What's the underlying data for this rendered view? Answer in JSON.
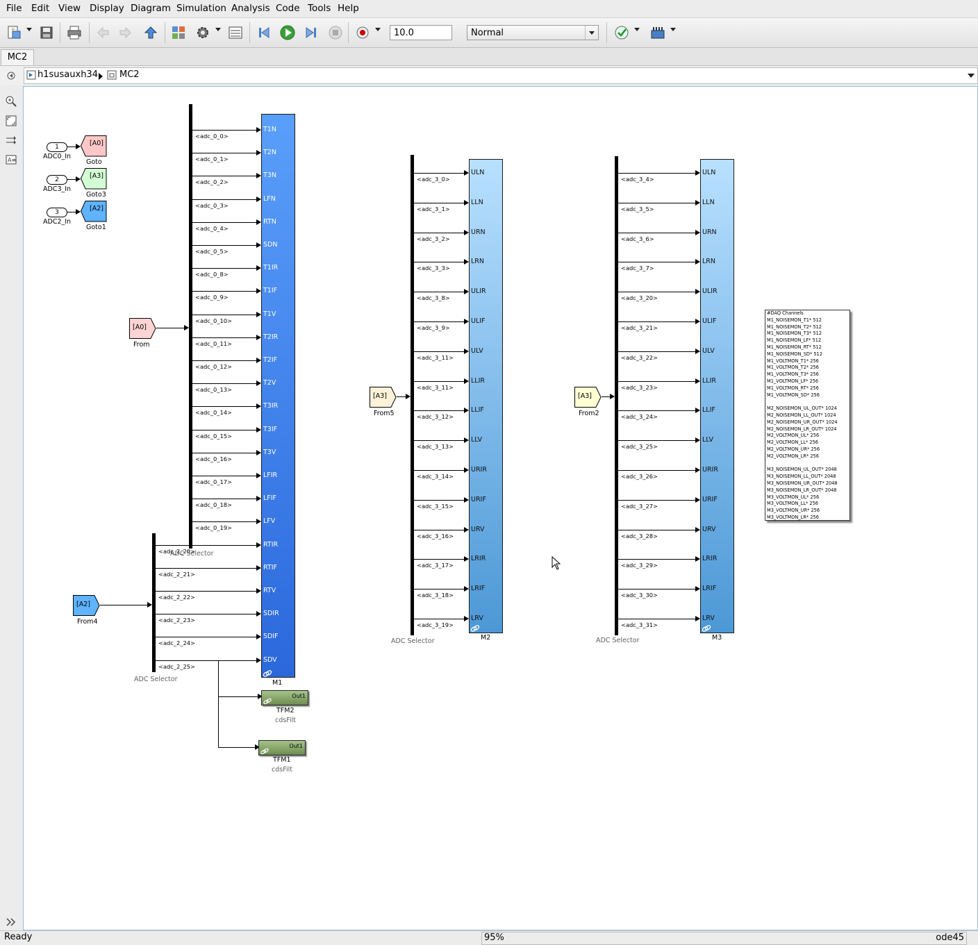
{
  "menu": [
    "File",
    "Edit",
    "View",
    "Display",
    "Diagram",
    "Simulation",
    "Analysis",
    "Code",
    "Tools",
    "Help"
  ],
  "toolbar": {
    "stop_time": "10.0",
    "sim_mode": "Normal"
  },
  "tab": {
    "label": "MC2"
  },
  "breadcrumb": {
    "parent": "h1susauxh34",
    "current": "MC2"
  },
  "status": {
    "left": "Ready",
    "zoom": "95%",
    "solver": "ode45"
  },
  "inports": [
    {
      "num": "1",
      "name": "ADC0_In",
      "tag": "[A0]",
      "goto": "Goto",
      "color": "#ffc8c8"
    },
    {
      "num": "2",
      "name": "ADC3_In",
      "tag": "[A3]",
      "goto": "Goto3",
      "color": "#d4ffd4"
    },
    {
      "num": "3",
      "name": "ADC2_In",
      "tag": "[A2]",
      "goto": "Goto1",
      "color": "#5fb3ff"
    }
  ],
  "froms": [
    {
      "tag": "[A0]",
      "name": "From",
      "color": "#ffd4d4"
    },
    {
      "tag": "[A2]",
      "name": "From4",
      "color": "#5fb3ff"
    },
    {
      "tag": "[A3]",
      "name": "From5",
      "color": "#fff2d9"
    },
    {
      "tag": "[A3]",
      "name": "From2",
      "color": "#ffffd4"
    }
  ],
  "selectors": {
    "s1": "ADC Selector",
    "s2": "ADC Selector",
    "s3": "ADC Selector",
    "s4": "ADC Selector"
  },
  "m1": {
    "name": "M1",
    "ports": [
      "T1N",
      "T2N",
      "T3N",
      "LFN",
      "RTN",
      "SDN",
      "T1IR",
      "T1IF",
      "T1V",
      "T2IR",
      "T2IF",
      "T2V",
      "T3IR",
      "T3IF",
      "T3V",
      "LFIR",
      "LFIF",
      "LFV",
      "RTIR",
      "RTIF",
      "RTV",
      "SDIR",
      "SDIF",
      "SDV"
    ],
    "signals_a": [
      "<adc_0_0>",
      "<adc_0_1>",
      "<adc_0_2>",
      "<adc_0_3>",
      "<adc_0_4>",
      "<adc_0_5>",
      "<adc_0_8>",
      "<adc_0_9>",
      "<adc_0_10>",
      "<adc_0_11>",
      "<adc_0_12>",
      "<adc_0_13>",
      "<adc_0_14>",
      "<adc_0_15>",
      "<adc_0_16>",
      "<adc_0_17>",
      "<adc_0_18>",
      "<adc_0_19>"
    ],
    "signals_b": [
      "<adc_2_20>",
      "<adc_2_21>",
      "<adc_2_22>",
      "<adc_2_23>",
      "<adc_2_24>",
      "<adc_2_25>"
    ]
  },
  "m2": {
    "name": "M2",
    "ports": [
      "ULN",
      "LLN",
      "URN",
      "LRN",
      "ULIR",
      "ULIF",
      "ULV",
      "LLIR",
      "LLIF",
      "LLV",
      "URIR",
      "URIF",
      "URV",
      "LRIR",
      "LRIF",
      "LRV"
    ],
    "signals": [
      "<adc_3_0>",
      "<adc_3_1>",
      "<adc_3_2>",
      "<adc_3_3>",
      "<adc_3_8>",
      "<adc_3_9>",
      "<adc_3_11>",
      "<adc_3_11>",
      "<adc_3_12>",
      "<adc_3_13>",
      "<adc_3_14>",
      "<adc_3_15>",
      "<adc_3_16>",
      "<adc_3_17>",
      "<adc_3_18>",
      "<adc_3_19>"
    ]
  },
  "m3": {
    "name": "M3",
    "ports": [
      "ULN",
      "LLN",
      "URN",
      "LRN",
      "ULIR",
      "ULIF",
      "ULV",
      "LLIR",
      "LLIF",
      "LLV",
      "URIR",
      "URIF",
      "URV",
      "LRIR",
      "LRIF",
      "LRV"
    ],
    "signals": [
      "<adc_3_4>",
      "<adc_3_5>",
      "<adc_3_6>",
      "<adc_3_7>",
      "<adc_3_20>",
      "<adc_3_21>",
      "<adc_3_22>",
      "<adc_3_23>",
      "<adc_3_24>",
      "<adc_3_25>",
      "<adc_3_26>",
      "<adc_3_27>",
      "<adc_3_28>",
      "<adc_3_29>",
      "<adc_3_30>",
      "<adc_3_31>"
    ]
  },
  "filters": [
    {
      "name": "TFM2",
      "lib": "cdsFilt",
      "out": "Out1"
    },
    {
      "name": "TFM1",
      "lib": "cdsFilt",
      "out": "Out1"
    }
  ],
  "daq_lines": [
    "#DAQ Channels",
    "M1_NOISEMON_T1* 512",
    "M1_NOISEMON_T2* 512",
    "M1_NOISEMON_T3* 512",
    "M1_NOISEMON_LF* 512",
    "M1_NOISEMON_RT* 512",
    "M1_NOISEMON_SD* 512",
    "M1_VOLTMON_T1* 256",
    "M1_VOLTMON_T2* 256",
    "M1_VOLTMON_T3* 256",
    "M1_VOLTMON_LF* 256",
    "M1_VOLTMON_RT* 256",
    "M1_VOLTMON_SD* 256",
    "",
    "M2_NOISEMON_UL_OUT* 1024",
    "M2_NOISEMON_LL_OUT* 1024",
    "M2_NOISEMON_UR_OUT* 1024",
    "M2_NOISEMON_LR_OUT* 1024",
    "M2_VOLTMON_UL* 256",
    "M2_VOLTMON_LL* 256",
    "M2_VOLTMON_UR* 256",
    "M2_VOLTMON_LR* 256",
    "",
    "M3_NOISEMON_UL_OUT* 2048",
    "M3_NOISEMON_LL_OUT* 2048",
    "M3_NOISEMON_UR_OUT* 2048",
    "M3_NOISEMON_LR_OUT* 2048",
    "M3_VOLTMON_UL* 256",
    "M3_VOLTMON_LL* 256",
    "M3_VOLTMON_UR* 256",
    "M3_VOLTMON_LR* 256"
  ],
  "colors": {
    "m1_top": "#5aa0ff",
    "m1_bottom": "#2d6fe0",
    "m2_top": "#b0dcff",
    "m2_bottom": "#4d9ad8",
    "filter": "#8aa86a"
  }
}
